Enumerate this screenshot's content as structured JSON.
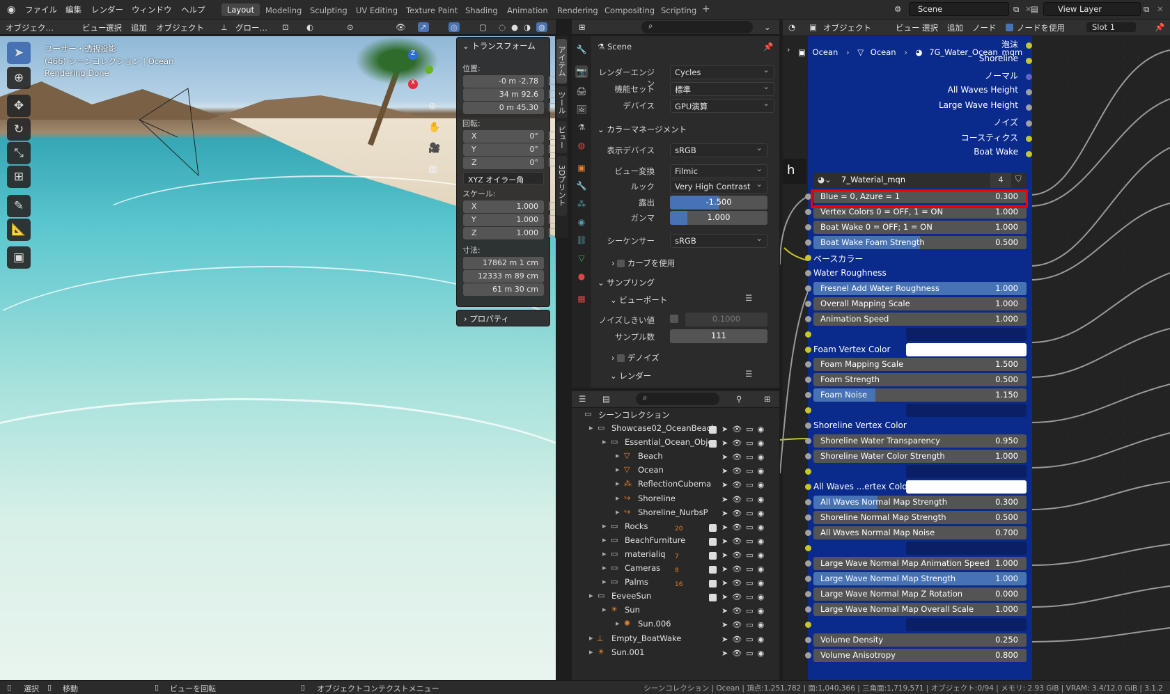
{
  "menu": {
    "items": [
      "ファイル",
      "編集",
      "レンダー",
      "ウィンドウ",
      "ヘルプ"
    ],
    "workspaces": [
      "Layout",
      "Modeling",
      "Sculpting",
      "UV Editing",
      "Texture Paint",
      "Shading",
      "Animation",
      "Rendering",
      "Compositing",
      "Scripting"
    ],
    "active_workspace": "Layout",
    "add_tab": "+",
    "scene": "Scene",
    "view_layer": "View Layer"
  },
  "viewport": {
    "header": {
      "mode": "オブジェク…",
      "view": "ビュー",
      "select": "選択",
      "add": "追加",
      "object": "オブジェクト",
      "orientation": "グロー…"
    },
    "overlay_lines": [
      "ユーザー・透視投影",
      "(466) シーンコレクション | Ocean",
      "Rendering Done"
    ],
    "side_tabs": [
      "アイテム",
      "ツール",
      "ビュー",
      "3Dプリント"
    ]
  },
  "npanel": {
    "title": "トランスフォーム",
    "location_label": "位置:",
    "location": [
      "-0 m -2.78",
      "34 m 92.6",
      "0 m 45.30"
    ],
    "rotation_label": "回転:",
    "rotation": [
      {
        "axis": "X",
        "value": "0°"
      },
      {
        "axis": "Y",
        "value": "0°"
      },
      {
        "axis": "Z",
        "value": "0°"
      }
    ],
    "rotation_mode": "XYZ オイラー角",
    "scale_label": "スケール:",
    "scale": [
      {
        "axis": "X",
        "value": "1.000"
      },
      {
        "axis": "Y",
        "value": "1.000"
      },
      {
        "axis": "Z",
        "value": "1.000"
      }
    ],
    "dimensions_label": "寸法:",
    "dimensions": [
      "17862 m 1 cm",
      "12333 m 89 cm",
      "61 m 30 cm"
    ],
    "properties_label": "プロパティ"
  },
  "properties": {
    "scene_name": "Scene",
    "render_engine_label": "レンダーエンジン",
    "render_engine": "Cycles",
    "feature_set_label": "機能セット",
    "feature_set": "標準",
    "device_label": "デバイス",
    "device": "GPU演算",
    "color_management": "カラーマネージメント",
    "display_device_label": "表示デバイス",
    "display_device": "sRGB",
    "view_transform_label": "ビュー変換",
    "view_transform": "Filmic",
    "look_label": "ルック",
    "look": "Very High Contrast",
    "exposure_label": "露出",
    "exposure": "-1.500",
    "gamma_label": "ガンマ",
    "gamma": "1.000",
    "sequencer_label": "シーケンサー",
    "sequencer": "sRGB",
    "use_curves": "カーブを使用",
    "sampling": "サンプリング",
    "viewport": "ビューポート",
    "noise_threshold_label": "ノイズしきい値",
    "noise_threshold": "0.1000",
    "samples_label": "サンプル数",
    "samples": "111",
    "denoise": "デノイズ",
    "render": "レンダー"
  },
  "outliner": {
    "root": "シーンコレクション",
    "rows": [
      {
        "name": "Showcase02_OceanBeacl",
        "indent": 1
      },
      {
        "name": "Essential_Ocean_Obje",
        "indent": 2
      },
      {
        "name": "Beach",
        "indent": 3
      },
      {
        "name": "Ocean",
        "indent": 3
      },
      {
        "name": "ReflectionCubema",
        "indent": 3
      },
      {
        "name": "Shoreline",
        "indent": 3
      },
      {
        "name": "Shoreline_NurbsP",
        "indent": 3
      },
      {
        "name": "Rocks",
        "indent": 2,
        "badge": "20"
      },
      {
        "name": "BeachFurniture",
        "indent": 2
      },
      {
        "name": "materialiq",
        "indent": 2,
        "badge": "7"
      },
      {
        "name": "Cameras",
        "indent": 2,
        "badge": "8"
      },
      {
        "name": "Palms",
        "indent": 2,
        "badge": "16"
      },
      {
        "name": "EeveeSun",
        "indent": 1
      },
      {
        "name": "Sun",
        "indent": 2
      },
      {
        "name": "Sun.006",
        "indent": 3
      },
      {
        "name": "Empty_BoatWake",
        "indent": 1
      },
      {
        "name": "Sun.001",
        "indent": 1
      }
    ]
  },
  "node_editor": {
    "header": {
      "type": "オブジェクト",
      "view": "ビュー",
      "select": "選択",
      "add": "追加",
      "node": "ノード",
      "use_nodes": "ノードを使用",
      "slot": "Slot 1"
    },
    "breadcrumb": [
      "Ocean",
      "Ocean",
      "7G_Water_Ocean_mqm"
    ],
    "outputs": [
      "泡沫",
      "Shoreline",
      "ノーマル",
      "All Waves Height",
      "Large Wave Height",
      "ノイズ",
      "コースティクス",
      "Boat Wake"
    ],
    "material_name": "7_Waterial_mqn",
    "material_users": "4",
    "inputs": [
      {
        "kind": "slider",
        "label": "Blue = 0, Azure = 1",
        "value": "0.300",
        "fill": 0.0
      },
      {
        "kind": "slider",
        "label": "Vertex Colors 0 = OFF, 1 = ON",
        "value": "1.000",
        "fill": 0.0
      },
      {
        "kind": "slider",
        "label": "Boat Wake 0 = OFF; 1 = ON",
        "value": "1.000",
        "fill": 0.0
      },
      {
        "kind": "slider",
        "label": "Boat Wake Foam Strength",
        "value": "0.500",
        "fill": 0.5
      },
      {
        "kind": "label",
        "label": "ベースカラー"
      },
      {
        "kind": "label",
        "label": "Water Roughness"
      },
      {
        "kind": "slider",
        "label": "Fresnel Add Water Roughness",
        "value": "1.000",
        "fill": 1.0
      },
      {
        "kind": "slider",
        "label": "Overall Mapping Scale",
        "value": "1.000",
        "fill": 0.0
      },
      {
        "kind": "slider",
        "label": "Animation Speed",
        "value": "1.000",
        "fill": 0.0
      },
      {
        "kind": "empty"
      },
      {
        "kind": "color",
        "label": "Foam Vertex Color"
      },
      {
        "kind": "slider",
        "label": "Foam Mapping Scale",
        "value": "1.500",
        "fill": 0.0
      },
      {
        "kind": "slider",
        "label": "Foam Strength",
        "value": "0.500",
        "fill": 0.0
      },
      {
        "kind": "slider",
        "label": "Foam Noise",
        "value": "1.150",
        "fill": 0.29
      },
      {
        "kind": "empty"
      },
      {
        "kind": "label",
        "label": "Shoreline Vertex Color"
      },
      {
        "kind": "slider",
        "label": "Shoreline Water Transparency",
        "value": "0.950",
        "fill": 0.0
      },
      {
        "kind": "slider",
        "label": "Shoreline Water Color Strength",
        "value": "1.000",
        "fill": 0.0
      },
      {
        "kind": "empty"
      },
      {
        "kind": "color",
        "label": "All Waves ...ertex Color"
      },
      {
        "kind": "slider",
        "label": "All Waves Normal Map Strength",
        "value": "0.300",
        "fill": 0.3
      },
      {
        "kind": "slider",
        "label": "Shoreline Normal Map Strength",
        "value": "0.500",
        "fill": 0.0
      },
      {
        "kind": "slider",
        "label": "All Waves Normal Map Noise",
        "value": "0.700",
        "fill": 0.0
      },
      {
        "kind": "empty"
      },
      {
        "kind": "slider",
        "label": "Large Wave Normal Map Animation Speed",
        "value": "1.000",
        "fill": 0.0
      },
      {
        "kind": "slider",
        "label": "Large Wave Normal Map Strength",
        "value": "1.000",
        "fill": 1.0
      },
      {
        "kind": "slider",
        "label": "Large Wave Normal Map Z Rotation",
        "value": "0.000",
        "fill": 0.0
      },
      {
        "kind": "slider",
        "label": "Large Wave Normal Map Overall Scale",
        "value": "1.000",
        "fill": 0.0
      },
      {
        "kind": "empty"
      },
      {
        "kind": "slider",
        "label": "Volume Density",
        "value": "0.250",
        "fill": 0.0
      },
      {
        "kind": "slider",
        "label": "Volume Anisotropy",
        "value": "0.800",
        "fill": 0.0
      }
    ]
  },
  "statusbar": {
    "select": "選択",
    "move": "移動",
    "rotate_view": "ビューを回転",
    "context_menu": "オブジェクトコンテクストメニュー",
    "stats": "シーンコレクション | Ocean | 頂点:1,251,782 | 面:1,040,366 | 三角面:1,719,571 | オブジェクト:0/94 | メモリ: 2.93 GiB | VRAM: 3.4/12.0 GiB | 3.1.2"
  },
  "colors": {
    "node_body": "#0a2a8c",
    "accent": "#4772b3",
    "highlight": "#e00000"
  }
}
